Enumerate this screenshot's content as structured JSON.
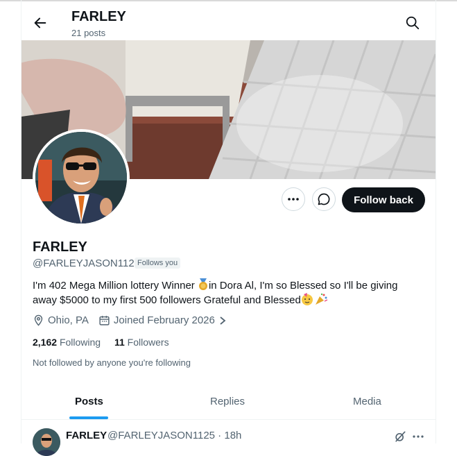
{
  "header": {
    "title": "FARLEY",
    "post_count": "21 posts"
  },
  "profile": {
    "name": "FARLEY",
    "handle": "@FARLEYJASON1125",
    "follows_you": "Follows you",
    "bio_part1": "I'm 402 Mega Million lottery Winner ",
    "bio_part2": "in Dora Al, I'm so Blessed so I'll be giving away $5000 to my first 500 followers Grateful and Blessed",
    "location": "Ohio, PA",
    "joined": "Joined February 2026",
    "following_count": "2,162",
    "following_label": "Following",
    "followers_count": "11",
    "followers_label": "Followers",
    "not_followed_text": "Not followed by anyone you're following"
  },
  "actions": {
    "follow_back_label": "Follow back"
  },
  "tabs": [
    {
      "label": "Posts",
      "active": true
    },
    {
      "label": "Replies",
      "active": false
    },
    {
      "label": "Media",
      "active": false
    }
  ],
  "post": {
    "name": "FARLEY",
    "handle_time": "@FARLEYJASON1125 · 18h"
  },
  "colors": {
    "accent": "#1d9bf0",
    "text": "#0f1419",
    "muted": "#536471",
    "button": "#0f1419"
  }
}
